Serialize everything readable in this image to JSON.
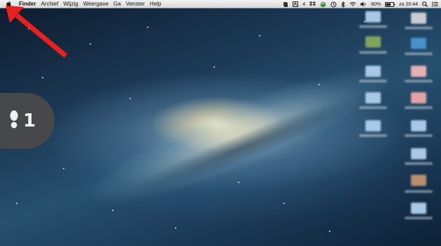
{
  "menubar": {
    "app_name": "Finder",
    "items": [
      "Archief",
      "Wijzig",
      "Weergave",
      "Ga",
      "Venster",
      "Help"
    ],
    "status": {
      "adobe_count": "4",
      "battery": "60%",
      "clock": "zo 20:44"
    }
  },
  "step": {
    "number": "1"
  },
  "colors": {
    "arrow": "#e8201f",
    "badge": "#4a4a4a"
  }
}
